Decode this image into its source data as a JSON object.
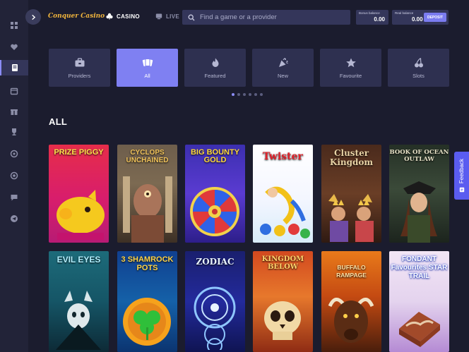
{
  "brand": {
    "logo_text": "Conquer Casino"
  },
  "nav": {
    "casino_label": "CASINO",
    "live_label": "LIVE"
  },
  "search": {
    "placeholder": "Find a game or a provider"
  },
  "balances": {
    "bonus_label": "Bonus balance",
    "bonus_value": "0.00",
    "real_label": "Real balance",
    "real_value": "0.00",
    "deposit_label": "DEPOSIT"
  },
  "categories": [
    {
      "label": "Providers",
      "icon": "briefcase-icon",
      "active": false
    },
    {
      "label": "All",
      "icon": "cards-icon",
      "active": true
    },
    {
      "label": "Featured",
      "icon": "flame-icon",
      "active": false
    },
    {
      "label": "New",
      "icon": "party-popper-icon",
      "active": false
    },
    {
      "label": "Favourite",
      "icon": "star-icon",
      "active": false
    },
    {
      "label": "Slots",
      "icon": "cherry-icon",
      "active": false
    }
  ],
  "carousel": {
    "pages": 6,
    "current": 1
  },
  "section": {
    "title": "ALL"
  },
  "games": [
    {
      "title": "PRIZE PIGGY"
    },
    {
      "title": "CYCLOPS UNCHAINED"
    },
    {
      "title": "BIG BOUNTY GOLD"
    },
    {
      "title": "Twister"
    },
    {
      "title": "Cluster Kingdom"
    },
    {
      "title": "BOOK OF OCEAN OUTLAW"
    },
    {
      "title": "EVIL EYES"
    },
    {
      "title": "3 SHAMROCK POTS"
    },
    {
      "title": "ZODIAC"
    },
    {
      "title": "KINGDOM BELOW"
    },
    {
      "title": "BUFFALO RAMPAGE"
    },
    {
      "title": "FONDANT Favourites STAR TRAIL"
    }
  ],
  "feedback": {
    "label": "Feedback"
  },
  "colors": {
    "accent": "#7f80f2",
    "background": "#1b1c2e",
    "sidebar": "#222338",
    "panel": "#2e3050"
  }
}
